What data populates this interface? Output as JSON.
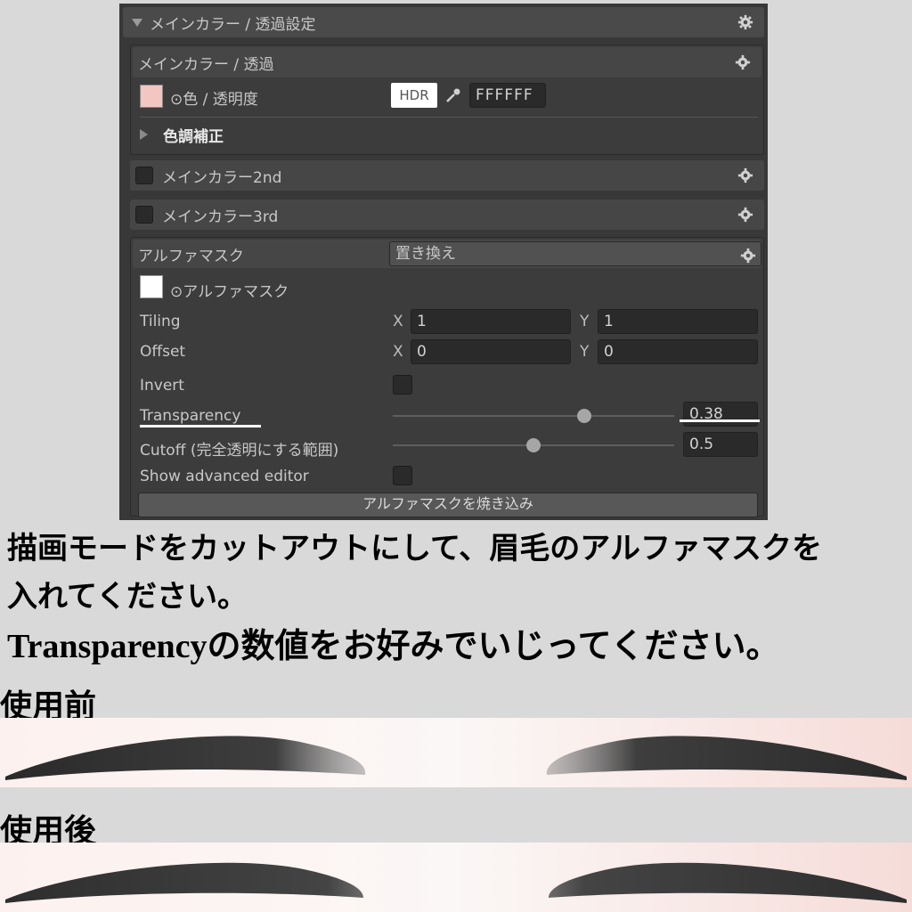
{
  "panel": {
    "main_header": "メインカラー / 透過設定",
    "main_color_section": {
      "title": "メインカラー / 透過",
      "color_label": "⊙色 / 透明度",
      "hdr_label": "HDR",
      "hex_value": "FFFFFF",
      "color_adjust_label": "色調補正"
    },
    "main_color_2nd": {
      "title": "メインカラー2nd"
    },
    "main_color_3rd": {
      "title": "メインカラー3rd"
    },
    "alpha_mask": {
      "title": "アルファマスク",
      "mode_value": "置き換え",
      "texture_label": "⊙アルファマスク",
      "tiling_label": "Tiling",
      "tiling_x": "1",
      "tiling_y": "1",
      "offset_label": "Offset",
      "offset_x": "0",
      "offset_y": "0",
      "axis_x": "X",
      "axis_y": "Y",
      "invert_label": "Invert",
      "transparency_label": "Transparency",
      "transparency_value": "0.38",
      "cutoff_label": "Cutoff (完全透明にする範囲)",
      "cutoff_value": "0.5",
      "advanced_label": "Show advanced editor",
      "bake_button": "アルファマスクを焼き込み"
    },
    "sliders": {
      "transparency_fraction": 0.68,
      "cutoff_fraction": 0.5
    }
  },
  "instructions": {
    "line1": "描画モードをカットアウトにして、眉毛のアルファマスクを",
    "line2": "入れてください。",
    "line3": "Transparencyの数値をお好みでいじってください。"
  },
  "before_label": "使用前",
  "after_label": "使用後",
  "colors": {
    "panel_bg": "#383838",
    "page_bg": "#d9d9d9",
    "skin": "#fbeeec",
    "brow": "#3a3a3a"
  }
}
